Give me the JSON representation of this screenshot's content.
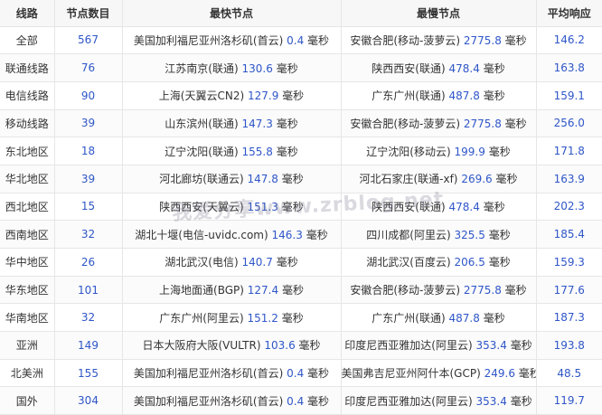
{
  "headers": [
    "线路",
    "节点数目",
    "最快节点",
    "最慢节点",
    "平均响应"
  ],
  "unit": "毫秒",
  "rows": [
    {
      "line": "全部",
      "count": "567",
      "fast_loc": "美国加利福尼亚州洛杉矶(首云)",
      "fast_ms": "0.4",
      "slow_loc": "安徽合肥(移动-菠萝云)",
      "slow_ms": "2775.8",
      "avg": "146.2"
    },
    {
      "line": "联通线路",
      "count": "76",
      "fast_loc": "江苏南京(联通)",
      "fast_ms": "130.6",
      "slow_loc": "陕西西安(联通)",
      "slow_ms": "478.4",
      "avg": "163.8"
    },
    {
      "line": "电信线路",
      "count": "90",
      "fast_loc": "上海(天翼云CN2)",
      "fast_ms": "127.9",
      "slow_loc": "广东广州(联通)",
      "slow_ms": "487.8",
      "avg": "159.1"
    },
    {
      "line": "移动线路",
      "count": "39",
      "fast_loc": "山东滨州(联通)",
      "fast_ms": "147.3",
      "slow_loc": "安徽合肥(移动-菠萝云)",
      "slow_ms": "2775.8",
      "avg": "256.0"
    },
    {
      "line": "东北地区",
      "count": "18",
      "fast_loc": "辽宁沈阳(联通)",
      "fast_ms": "155.8",
      "slow_loc": "辽宁沈阳(移动云)",
      "slow_ms": "199.9",
      "avg": "171.8"
    },
    {
      "line": "华北地区",
      "count": "39",
      "fast_loc": "河北廊坊(联通云)",
      "fast_ms": "147.8",
      "slow_loc": "河北石家庄(联通-xf)",
      "slow_ms": "269.6",
      "avg": "163.9"
    },
    {
      "line": "西北地区",
      "count": "15",
      "fast_loc": "陕西西安(天翼云)",
      "fast_ms": "151.3",
      "slow_loc": "陕西西安(联通)",
      "slow_ms": "478.4",
      "avg": "202.3"
    },
    {
      "line": "西南地区",
      "count": "32",
      "fast_loc": "湖北十堰(电信-uvidc.com)",
      "fast_ms": "146.3",
      "slow_loc": "四川成都(阿里云)",
      "slow_ms": "325.5",
      "avg": "185.4"
    },
    {
      "line": "华中地区",
      "count": "26",
      "fast_loc": "湖北武汉(电信)",
      "fast_ms": "140.7",
      "slow_loc": "湖北武汉(百度云)",
      "slow_ms": "206.5",
      "avg": "159.3"
    },
    {
      "line": "华东地区",
      "count": "101",
      "fast_loc": "上海地面通(BGP)",
      "fast_ms": "127.4",
      "slow_loc": "安徽合肥(移动-菠萝云)",
      "slow_ms": "2775.8",
      "avg": "177.6"
    },
    {
      "line": "华南地区",
      "count": "32",
      "fast_loc": "广东广州(阿里云)",
      "fast_ms": "151.2",
      "slow_loc": "广东广州(联通)",
      "slow_ms": "487.8",
      "avg": "187.3"
    },
    {
      "line": "亚洲",
      "count": "149",
      "fast_loc": "日本大阪府大阪(VULTR)",
      "fast_ms": "103.6",
      "slow_loc": "印度尼西亚雅加达(阿里云)",
      "slow_ms": "353.4",
      "avg": "193.8"
    },
    {
      "line": "北美洲",
      "count": "155",
      "fast_loc": "美国加利福尼亚州洛杉矶(首云)",
      "fast_ms": "0.4",
      "slow_loc": "美国弗吉尼亚州阿什本(GCP)",
      "slow_ms": "249.6",
      "avg": "48.5"
    },
    {
      "line": "国外",
      "count": "304",
      "fast_loc": "美国加利福尼亚州洛杉矶(首云)",
      "fast_ms": "0.4",
      "slow_loc": "印度尼西亚雅加达(阿里云)",
      "slow_ms": "353.4",
      "avg": "119.7"
    }
  ],
  "watermark": "我爱分享www.zrblog.net"
}
